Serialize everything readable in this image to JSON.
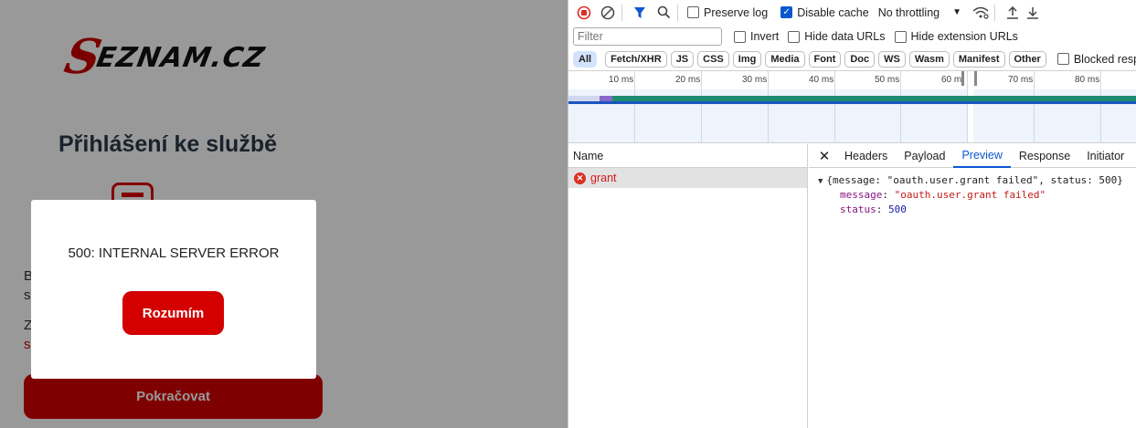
{
  "app": {
    "logo_s": "S",
    "logo_rest": "EZNAM.CZ",
    "title": "Přihlášení ke službě",
    "bg_line1": "B",
    "bg_line2": "s",
    "bg_line3": "Z",
    "bg_line4": "s",
    "continue_label": "Pokračovat",
    "modal": {
      "message": "500: INTERNAL SERVER ERROR",
      "button": "Rozumím"
    }
  },
  "devtools": {
    "toolbar": {
      "preserve_log": "Preserve log",
      "disable_cache": "Disable cache",
      "throttling": "No throttling"
    },
    "filter": {
      "placeholder": "Filter",
      "invert": "Invert",
      "hide_data_urls": "Hide data URLs",
      "hide_extension_urls": "Hide extension URLs"
    },
    "types": [
      "All",
      "Fetch/XHR",
      "JS",
      "CSS",
      "Img",
      "Media",
      "Font",
      "Doc",
      "WS",
      "Wasm",
      "Manifest",
      "Other"
    ],
    "blocked_responses": "Blocked respons",
    "timeline_ticks": [
      "10 ms",
      "20 ms",
      "30 ms",
      "40 ms",
      "50 ms",
      "60 m",
      "70 ms",
      "80 ms"
    ],
    "list_header": "Name",
    "request_name": "grant",
    "tabs": [
      "Headers",
      "Payload",
      "Preview",
      "Response",
      "Initiator"
    ],
    "active_tab": "Preview",
    "preview": {
      "summary": "{message: \"oauth.user.grant failed\", status: 500}",
      "message_key": "message",
      "message_value": "\"oauth.user.grant failed\"",
      "status_key": "status",
      "status_value": "500"
    }
  }
}
